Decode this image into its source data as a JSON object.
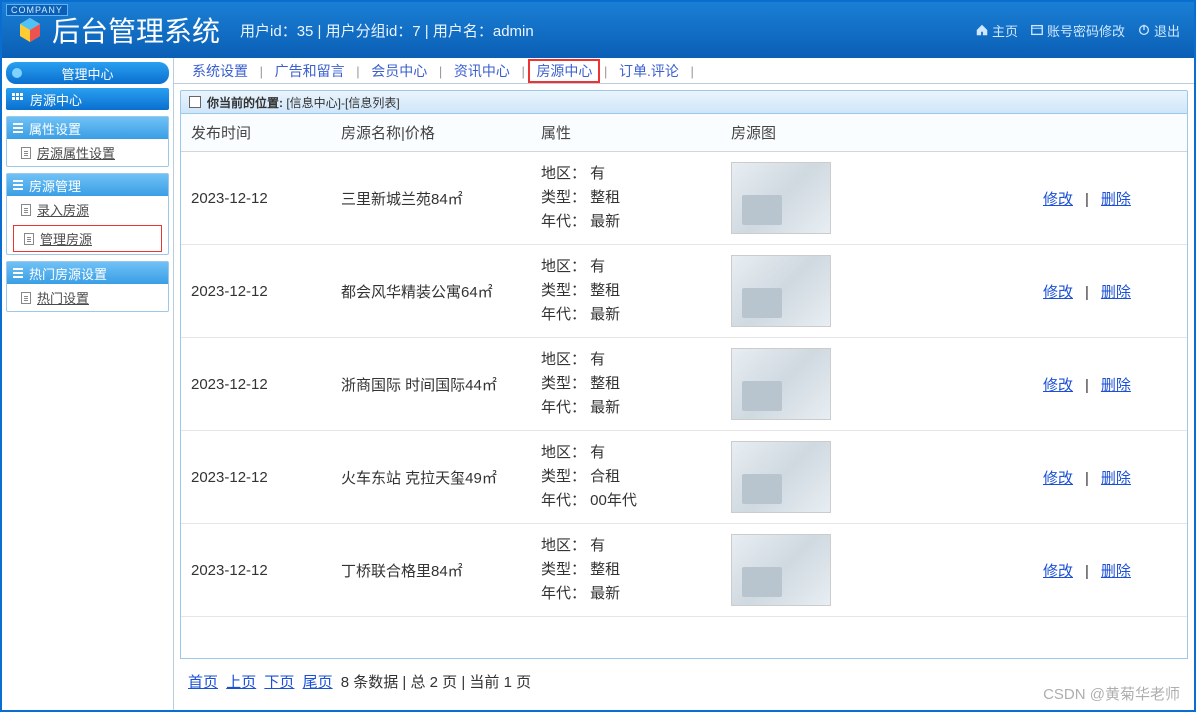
{
  "header": {
    "company_tag": "COMPANY",
    "title": "后台管理系统",
    "userinfo": "用户id：35 | 用户分组id：7 | 用户名：admin",
    "links": {
      "home": "主页",
      "account": "账号密码修改",
      "logout": "退出"
    }
  },
  "sidebar": {
    "center_label": "管理中心",
    "section_label": "房源中心",
    "groups": [
      {
        "title": "属性设置",
        "items": [
          {
            "label": "房源属性设置",
            "highlight": false
          }
        ]
      },
      {
        "title": "房源管理",
        "items": [
          {
            "label": "录入房源",
            "highlight": false
          },
          {
            "label": "管理房源",
            "highlight": true
          }
        ]
      },
      {
        "title": "热门房源设置",
        "items": [
          {
            "label": "热门设置",
            "highlight": false
          }
        ]
      }
    ]
  },
  "topnav": {
    "items": [
      {
        "label": "系统设置",
        "highlight": false
      },
      {
        "label": "广告和留言",
        "highlight": false
      },
      {
        "label": "会员中心",
        "highlight": false
      },
      {
        "label": "资讯中心",
        "highlight": false
      },
      {
        "label": "房源中心",
        "highlight": true
      },
      {
        "label": "订单.评论",
        "highlight": false
      }
    ],
    "sep": "|"
  },
  "breadcrumb": {
    "prefix": "你当前的位置:",
    "path": "[信息中心]-[信息列表]"
  },
  "table": {
    "headers": {
      "time": "发布时间",
      "name": "房源名称|价格",
      "attr": "属性",
      "img": "房源图",
      "ops": ""
    },
    "attr_labels": {
      "region": "地区：",
      "type": "类型：",
      "era": "年代："
    },
    "actions": {
      "edit": "修改",
      "del": "删除",
      "sep": "|"
    },
    "rows": [
      {
        "time": "2023-12-12",
        "name": "三里新城兰苑84㎡",
        "region": "有",
        "type": "整租",
        "era": "最新"
      },
      {
        "time": "2023-12-12",
        "name": "都会风华精装公寓64㎡",
        "region": "有",
        "type": "整租",
        "era": "最新"
      },
      {
        "time": "2023-12-12",
        "name": "浙商国际 时间国际44㎡",
        "region": "有",
        "type": "整租",
        "era": "最新"
      },
      {
        "time": "2023-12-12",
        "name": "火车东站 克拉天玺49㎡",
        "region": "有",
        "type": "合租",
        "era": "00年代"
      },
      {
        "time": "2023-12-12",
        "name": "丁桥联合格里84㎡",
        "region": "有",
        "type": "整租",
        "era": "最新"
      }
    ]
  },
  "pager": {
    "first": "首页",
    "prev": "上页",
    "next": "下页",
    "last": "尾页",
    "summary": "8 条数据 | 总 2 页 | 当前 1 页"
  },
  "watermark": "CSDN @黄菊华老师"
}
